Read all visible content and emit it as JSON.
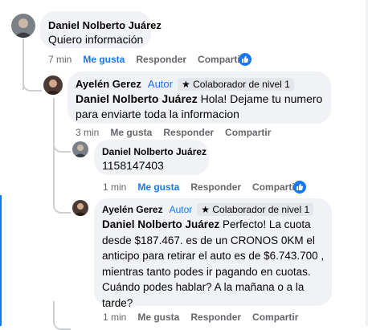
{
  "comments": [
    {
      "author": "Daniel Nolberto Juárez",
      "text": "Quiero información",
      "time": "7 min",
      "like_label": "Me gusta",
      "reply_label": "Responder",
      "share_label": "Compartir"
    },
    {
      "author": "Ayelén Gerez",
      "author_tag": "Autor",
      "badge": "Colaborador de nivel 1",
      "mention": "Daniel Nolberto Juárez",
      "text": " Hola! Dejame tu numero para enviarte toda la informacion",
      "time": "3 min",
      "like_label": "Me gusta",
      "reply_label": "Responder",
      "share_label": "Compartir"
    },
    {
      "author": "Daniel Nolberto Juárez",
      "text": "1158147403",
      "time": "1 min",
      "like_label": "Me gusta",
      "reply_label": "Responder",
      "share_label": "Compartir"
    },
    {
      "author": "Ayelén Gerez",
      "author_tag": "Autor",
      "badge": "Colaborador de nivel 1",
      "mention": "Daniel Nolberto Juárez",
      "text": " Perfecto! La cuota desde $187.467. es de un CRONOS 0KM el anticipo para retirar el auto es de $6.743.700 , mientras tanto podes ir pagando en cuotas. Cuándo podes hablar? A la mañana o a la tarde?",
      "time": "1 min",
      "like_label": "Me gusta",
      "reply_label": "Responder",
      "share_label": "Compartir"
    }
  ],
  "icons": {
    "like_reaction": "thumbs-up-icon",
    "badge_star": "star-icon"
  },
  "colors": {
    "link_blue": "#1877f2",
    "bubble_bg": "#f0f2f5",
    "meta_gray": "#65676b"
  }
}
